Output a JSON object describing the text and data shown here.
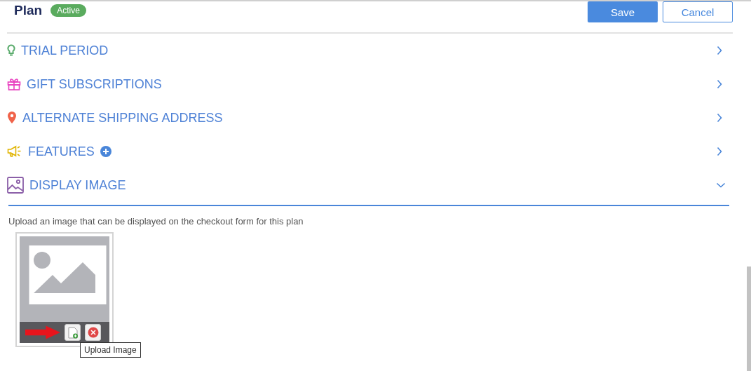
{
  "header": {
    "title": "Plan",
    "status": "Active"
  },
  "buttons": [
    {
      "label": "Save",
      "kind": "primary"
    },
    {
      "label": "Cancel",
      "kind": "secondary"
    }
  ],
  "sections": [
    {
      "label": "TRIAL PERIOD",
      "kind": "bulb",
      "expanded": false
    },
    {
      "label": "GIFT SUBSCRIPTIONS",
      "kind": "gift",
      "expanded": false
    },
    {
      "label": "ALTERNATE SHIPPING ADDRESS",
      "kind": "pin",
      "expanded": false
    },
    {
      "label": "FEATURES",
      "kind": "megaphone",
      "expanded": false,
      "add_button": true
    },
    {
      "label": "DISPLAY IMAGE",
      "kind": "image",
      "expanded": true
    }
  ],
  "display_image": {
    "description": "Upload an image that can be displayed on the checkout form for this plan",
    "tooltip": "Upload Image"
  }
}
